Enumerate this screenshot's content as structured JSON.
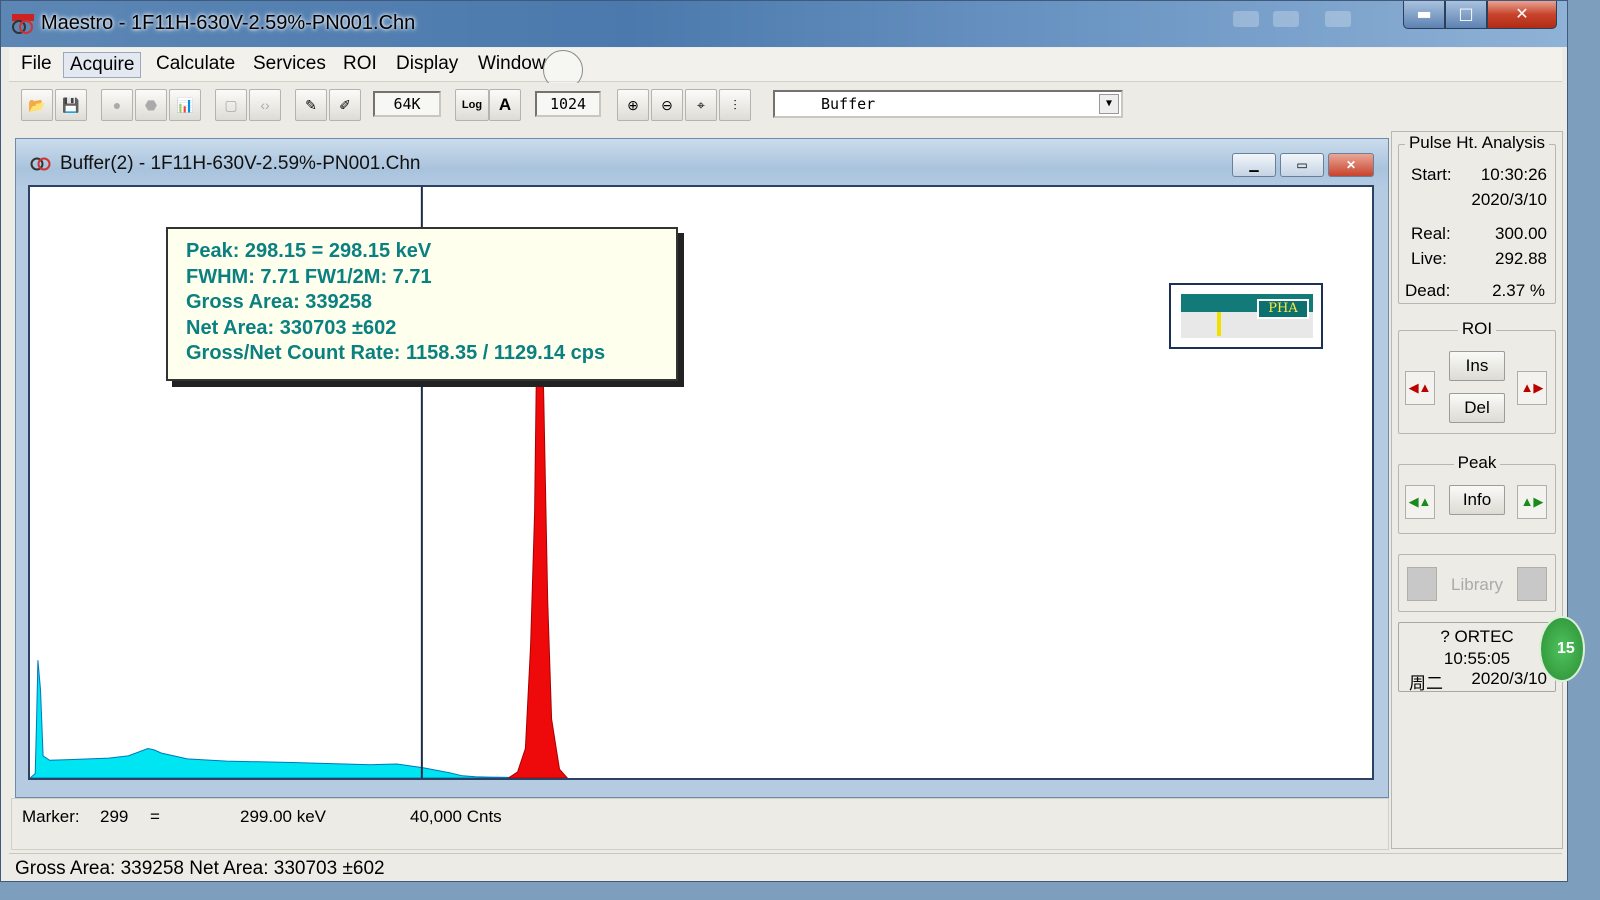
{
  "window": {
    "title": "Maestro - 1F11H-630V-2.59%-PN001.Chn",
    "controls": {
      "minimize": "▬",
      "maximize": "□",
      "close": "✕"
    }
  },
  "menu": [
    "File",
    "Acquire",
    "Calculate",
    "Services",
    "ROI",
    "Display",
    "Window"
  ],
  "toolbar": {
    "memory_size": "64K",
    "log_label": "Log",
    "auto_label": "A",
    "vertical_scale": "1024",
    "buffer_select": "Buffer"
  },
  "child_window": {
    "title": "Buffer(2) - 1F11H-630V-2.59%-PN001.Chn"
  },
  "peak_info": {
    "peak": "Peak: 298.15 = 298.15 keV",
    "fwhm": "FWHM: 7.71  FW1/2M: 7.71",
    "gross_area": "Gross Area: 339258",
    "net_area": "Net Area: 330703 ±602",
    "count_rate": "Gross/Net Count Rate: 1158.35 / 1129.14 cps"
  },
  "pha_label": "PHA",
  "marker": {
    "label": "Marker:",
    "channel": "299",
    "equals": "=",
    "energy": "299.00  keV",
    "counts": "40,000  Cnts"
  },
  "status": "Gross Area: 339258  Net Area: 330703 ±602",
  "pulse_height": {
    "title": "Pulse Ht. Analysis",
    "start_label": "Start:",
    "start_time": "10:30:26",
    "start_date": "2020/3/10",
    "real_label": "Real:",
    "real_value": "300.00",
    "live_label": "Live:",
    "live_value": "292.88",
    "dead_label": "Dead:",
    "dead_value": "2.37  %"
  },
  "roi": {
    "title": "ROI",
    "ins": "Ins",
    "del": "Del"
  },
  "peak_group": {
    "title": "Peak",
    "info": "Info"
  },
  "library": {
    "label": "Library"
  },
  "clock": {
    "vendor": "? ORTEC",
    "time": "10:55:05",
    "day": "周二",
    "date": "2020/3/10",
    "badge": "15"
  },
  "chart_data": {
    "type": "area",
    "xlabel": "",
    "ylabel": "",
    "series": [
      {
        "color": "#00e5f2",
        "x": [
          0,
          4,
          5,
          6,
          8,
          10,
          15,
          30,
          45,
          60,
          75,
          90,
          95,
          100,
          120,
          150,
          200,
          240,
          260,
          280,
          300,
          320,
          330,
          340,
          350,
          365,
          380
        ],
        "values": [
          0,
          300,
          4000,
          8000,
          6000,
          1500,
          1200,
          1250,
          1300,
          1350,
          1500,
          2000,
          1900,
          1700,
          1300,
          1150,
          1050,
          950,
          900,
          950,
          700,
          350,
          150,
          90,
          60,
          40,
          0
        ]
      },
      {
        "color": "#ee0a0a",
        "x": [
          365,
          372,
          378,
          382,
          385,
          387,
          390,
          392,
          395,
          398,
          404,
          410
        ],
        "values": [
          0,
          400,
          2000,
          9000,
          18000,
          32000,
          33000,
          26000,
          12000,
          4000,
          600,
          0
        ]
      }
    ],
    "marker_channel": 299,
    "x_range": [
      0,
      1024
    ],
    "ylim": [
      0,
      40000
    ]
  }
}
